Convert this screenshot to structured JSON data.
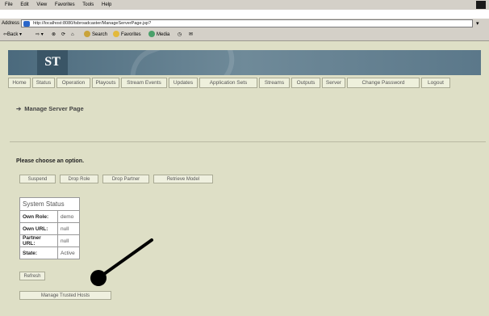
{
  "browser": {
    "menu": [
      "File",
      "Edit",
      "View",
      "Favorites",
      "Tools",
      "Help"
    ],
    "address_label": "Address",
    "url": "http://localhost:8080/tsbroadcaster/ManageServerPage.jsp?",
    "toolbar": {
      "back": "Back",
      "search": "Search",
      "favorites": "Favorites",
      "media": "Media"
    }
  },
  "banner": {
    "logo": "ST"
  },
  "nav": [
    "Home",
    "Status",
    "Operation",
    "Playouts",
    "Stream Events",
    "Updates",
    "Application Sets",
    "Streams",
    "Outputs",
    "Server",
    "Change Password",
    "Logout"
  ],
  "page": {
    "title": "Manage Server Page",
    "prompt": "Please choose an option.",
    "actions": [
      "Suspend",
      "Drop Role",
      "Drop Partner",
      "Retrieve Model"
    ],
    "status": {
      "heading": "System Status",
      "rows": [
        {
          "label": "Own Role:",
          "value": "demo"
        },
        {
          "label": "Own URL:",
          "value": "null"
        },
        {
          "label": "Partner URL:",
          "value": "null"
        },
        {
          "label": "State:",
          "value": "Active"
        }
      ]
    },
    "refresh": "Refresh",
    "trusted_hosts": "Manage Trusted Hosts"
  },
  "annotation": {
    "pointer_color": "#000000"
  }
}
